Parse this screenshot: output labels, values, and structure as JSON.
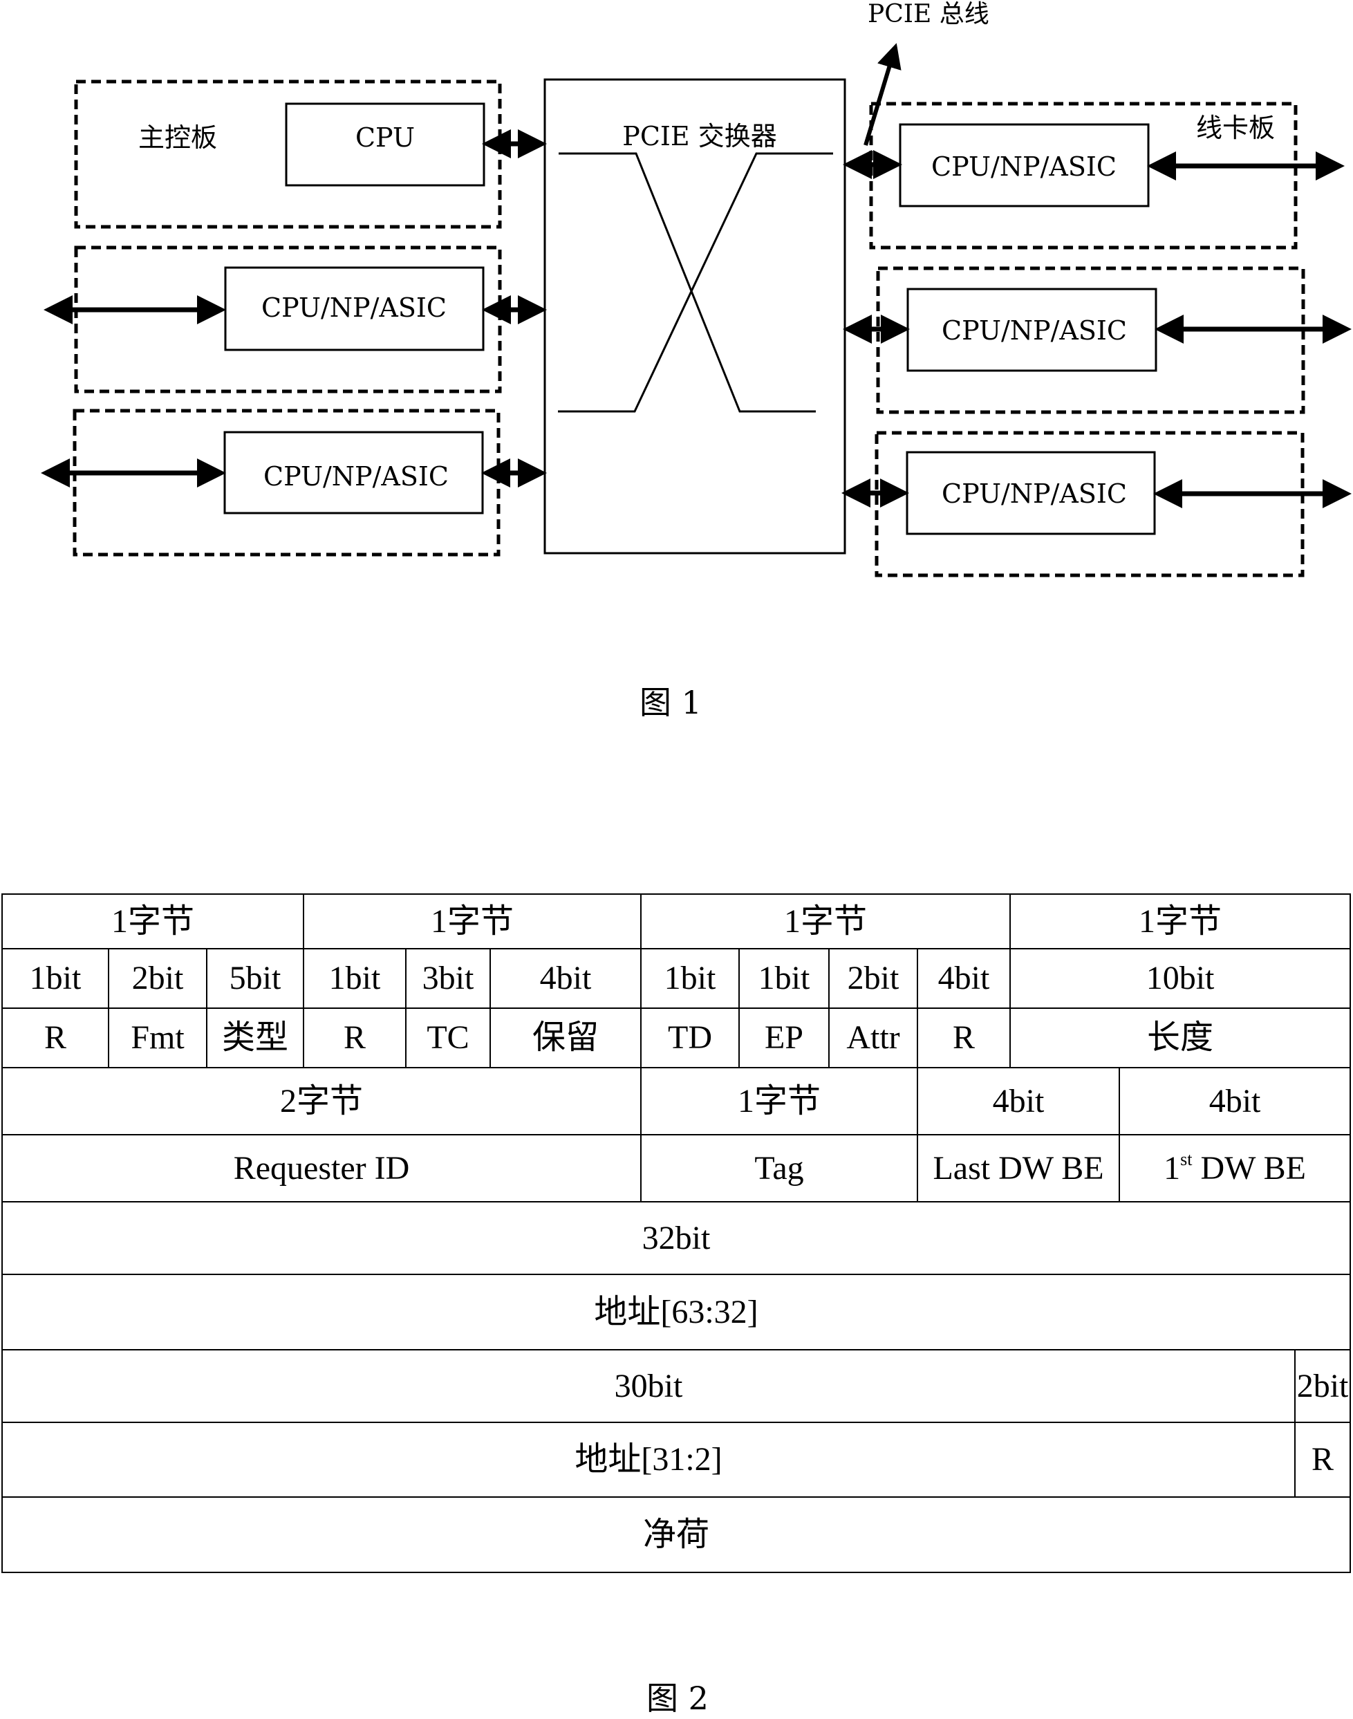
{
  "figure1": {
    "caption": "图 1",
    "bus_label": "PCIE 总线",
    "switch_label": "PCIE 交换器",
    "main_board_label": "主控板",
    "line_card_label": "线卡板",
    "main_cpu_label": "CPU",
    "left_chips": [
      "CPU/NP/ASIC",
      "CPU/NP/ASIC"
    ],
    "right_chips": [
      "CPU/NP/ASIC",
      "CPU/NP/ASIC",
      "CPU/NP/ASIC"
    ]
  },
  "figure2": {
    "caption": "图 2",
    "row1": [
      "1字节",
      "1字节",
      "1字节",
      "1字节"
    ],
    "row2": [
      "1bit",
      "2bit",
      "5bit",
      "1bit",
      "3bit",
      "4bit",
      "1bit",
      "1bit",
      "2bit",
      "4bit",
      "10bit"
    ],
    "row3": [
      "R",
      "Fmt",
      "类型",
      "R",
      "TC",
      "保留",
      "TD",
      "EP",
      "Attr",
      "R",
      "长度"
    ],
    "row4": [
      "2字节",
      "1字节",
      "4bit",
      "4bit"
    ],
    "row5": {
      "requester_id": "Requester ID",
      "tag": "Tag",
      "last_dw_be": "Last DW BE",
      "first_dw_be_num": "1",
      "first_dw_be_sup": "st",
      "first_dw_be_rest": " DW BE"
    },
    "row6": [
      "32bit"
    ],
    "row7": [
      "地址[63:32]"
    ],
    "row8": [
      "30bit",
      "2bit"
    ],
    "row9": [
      "地址[31:2]",
      "R"
    ],
    "row10": [
      "净荷"
    ]
  }
}
